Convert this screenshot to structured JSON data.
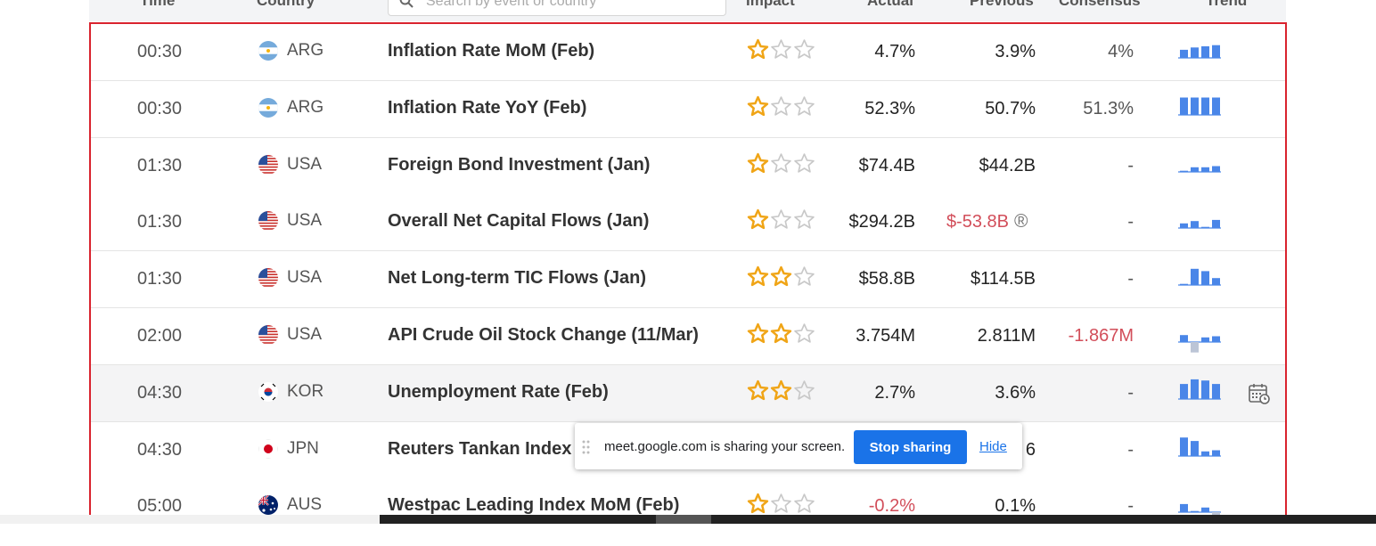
{
  "header": {
    "time": "Time",
    "country": "Country",
    "search_placeholder": "Search by event or country",
    "impact": "Impact",
    "actual": "Actual",
    "previous": "Previous",
    "consensus": "Consensus",
    "trend": "Trend"
  },
  "rows": [
    {
      "time": "00:30",
      "country": "ARG",
      "event": "Inflation Rate MoM (Feb)",
      "impact": 1,
      "actual": "4.7%",
      "previous": "3.9%",
      "consensus": "4%",
      "trend": [
        0.35,
        0.45,
        0.5,
        0.55
      ],
      "flag": "argentina-flag-icon"
    },
    {
      "time": "00:30",
      "country": "ARG",
      "event": "Inflation Rate YoY (Feb)",
      "impact": 1,
      "actual": "52.3%",
      "previous": "50.7%",
      "consensus": "51.3%",
      "trend": [
        0.75,
        0.75,
        0.75,
        0.75
      ],
      "flag": "argentina-flag-icon"
    },
    {
      "time": "01:30",
      "country": "USA",
      "event": "Foreign Bond Investment (Jan)",
      "impact": 1,
      "actual": "$74.4B",
      "previous": "$44.2B",
      "consensus": "-",
      "trend": [
        0.05,
        0.2,
        0.2,
        0.25
      ],
      "flag": "usa-flag-icon"
    },
    {
      "time": "01:30",
      "country": "USA",
      "event": "Overall Net Capital Flows (Jan)",
      "impact": 1,
      "actual": "$294.2B",
      "previous": "$-53.8B",
      "previous_revised": "®",
      "consensus": "-",
      "trend": [
        0.2,
        0.3,
        0.05,
        0.35
      ],
      "flag": "usa-flag-icon"
    },
    {
      "time": "01:30",
      "country": "USA",
      "event": "Net Long-term TIC Flows (Jan)",
      "impact": 2,
      "actual": "$58.8B",
      "previous": "$114.5B",
      "consensus": "-",
      "trend": [
        0.05,
        0.7,
        0.6,
        0.3
      ],
      "flag": "usa-flag-icon"
    },
    {
      "time": "02:00",
      "country": "USA",
      "event": "API Crude Oil Stock Change (11/Mar)",
      "impact": 2,
      "actual": "3.754M",
      "previous": "2.811M",
      "consensus": "-1.867M",
      "trend": [
        0.3,
        -0.45,
        0.2,
        0.25
      ],
      "flag": "usa-flag-icon"
    },
    {
      "time": "04:30",
      "country": "KOR",
      "event": "Unemployment Rate (Feb)",
      "impact": 2,
      "actual": "2.7%",
      "previous": "3.6%",
      "consensus": "-",
      "trend": [
        0.65,
        0.85,
        0.8,
        0.65
      ],
      "flag": "south-korea-flag-icon"
    },
    {
      "time": "04:30",
      "country": "JPN",
      "event": "Reuters Tankan Index (Mar)",
      "impact": 1,
      "actual": "",
      "previous": "6",
      "consensus": "-",
      "trend": [
        0.8,
        0.65,
        0.2,
        0.25
      ],
      "flag": "japan-flag-icon"
    },
    {
      "time": "05:00",
      "country": "AUS",
      "event": "Westpac Leading Index MoM (Feb)",
      "impact": 1,
      "actual": "-0.2%",
      "previous": "0.1%",
      "consensus": "-",
      "trend": [
        0.35,
        0.05,
        0.2,
        -0.3
      ],
      "flag": "australia-flag-icon"
    }
  ],
  "screen_share": {
    "message": "meet.google.com is sharing your screen.",
    "stop_label": "Stop sharing",
    "hide_label": "Hide"
  },
  "colors": {
    "accent_red": "#d9232e",
    "negative_text": "#d24e5a",
    "trend_bar": "#4a86e8",
    "trend_bar_current": "#bcc5d6",
    "star_gold": "#f0a517"
  }
}
